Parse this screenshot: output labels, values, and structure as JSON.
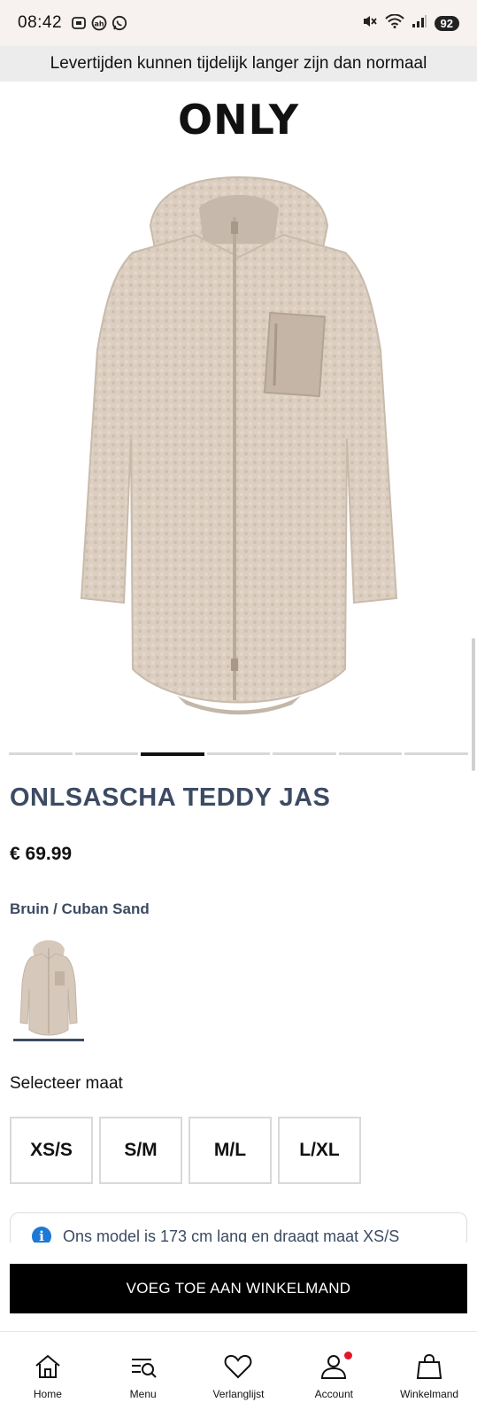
{
  "status_bar": {
    "time": "08:42",
    "battery": "92",
    "left_icons": [
      "screenshot-icon",
      "albert-heijn-icon",
      "whatsapp-icon"
    ],
    "right_icons": [
      "mute-icon",
      "wifi-icon",
      "signal-icon"
    ]
  },
  "banner": {
    "text": "Levertijden kunnen tijdelijk langer zijn dan normaal"
  },
  "brand": {
    "logo": "ONLY"
  },
  "product": {
    "title": "ONLSASCHA TEDDY JAS",
    "price": "€ 69.99",
    "color": "Bruin / Cuban Sand",
    "image_alt_color": "#d8cbbd",
    "carousel": {
      "count": 7,
      "active_index": 2
    }
  },
  "sizes": {
    "label": "Selecteer maat",
    "options": [
      "XS/S",
      "S/M",
      "M/L",
      "L/XL"
    ]
  },
  "info": {
    "text": "Ons model is 173 cm lang en draagt maat XS/S",
    "icon": "info-icon"
  },
  "cart": {
    "button_label": "VOEG TOE AAN WINKELMAND"
  },
  "nav": {
    "items": [
      {
        "label": "Home",
        "icon": "home-icon"
      },
      {
        "label": "Menu",
        "icon": "menu-search-icon"
      },
      {
        "label": "Verlanglijst",
        "icon": "heart-icon"
      },
      {
        "label": "Account",
        "icon": "account-icon",
        "notification": true
      },
      {
        "label": "Winkelmand",
        "icon": "bag-icon"
      }
    ]
  },
  "colors": {
    "accent": "#3c4b63",
    "notification": "#e0162b",
    "info": "#1d78d6"
  }
}
